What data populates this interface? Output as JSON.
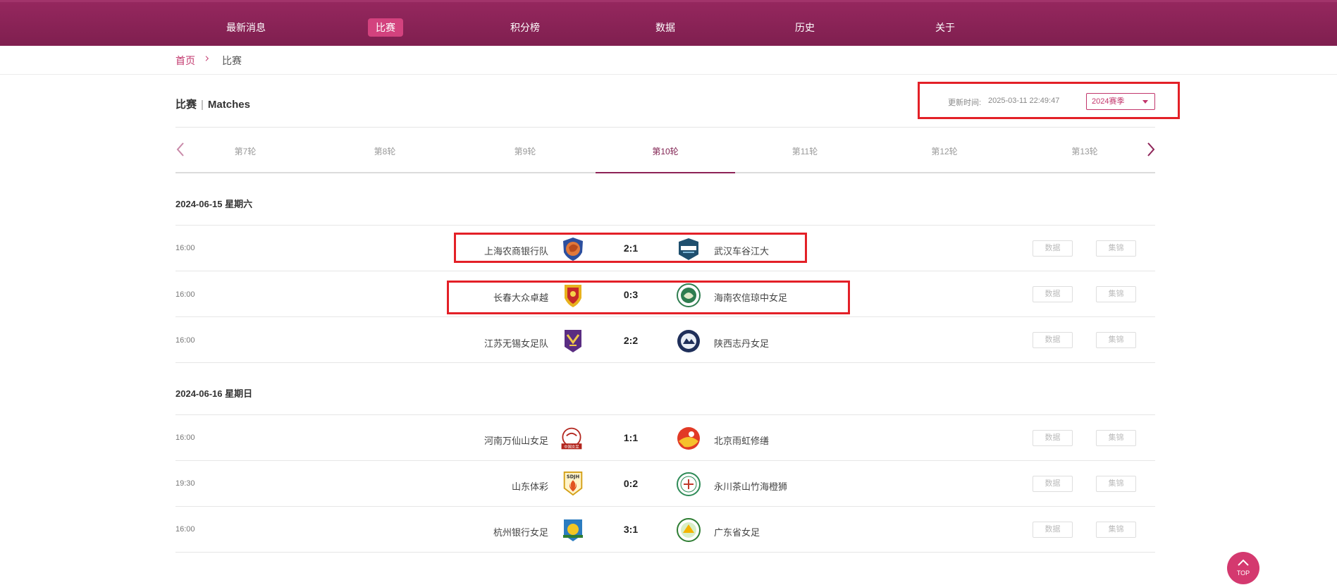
{
  "nav": {
    "items": [
      {
        "label": "最新消息",
        "active": false
      },
      {
        "label": "比赛",
        "active": true
      },
      {
        "label": "积分榜",
        "active": false
      },
      {
        "label": "数据",
        "active": false
      },
      {
        "label": "历史",
        "active": false
      },
      {
        "label": "关于",
        "active": false
      }
    ]
  },
  "breadcrumb": {
    "home": "首页",
    "current": "比赛"
  },
  "section": {
    "title_cn": "比赛",
    "title_en": "Matches"
  },
  "update": {
    "label": "更新时间:",
    "time": "2025-03-11 22:49:47"
  },
  "season_select": {
    "value": "2024赛季"
  },
  "rounds": {
    "tabs": [
      "第7轮",
      "第8轮",
      "第9轮",
      "第10轮",
      "第11轮",
      "第12轮",
      "第13轮"
    ],
    "active": "第10轮"
  },
  "days": [
    {
      "date": "2024-06-15 星期六",
      "matches": [
        {
          "time": "16:00",
          "home": "上海农商银行队",
          "score": "2:1",
          "away": "武汉车谷江大",
          "btn_data": "数据",
          "btn_highlights": "集锦"
        },
        {
          "time": "16:00",
          "home": "长春大众卓越",
          "score": "0:3",
          "away": "海南农信琼中女足",
          "btn_data": "数据",
          "btn_highlights": "集锦"
        },
        {
          "time": "16:00",
          "home": "江苏无锡女足队",
          "score": "2:2",
          "away": "陕西志丹女足",
          "btn_data": "数据",
          "btn_highlights": "集锦"
        }
      ]
    },
    {
      "date": "2024-06-16 星期日",
      "matches": [
        {
          "time": "16:00",
          "home": "河南万仙山女足",
          "score": "1:1",
          "away": "北京雨虹修缮",
          "btn_data": "数据",
          "btn_highlights": "集锦"
        },
        {
          "time": "19:30",
          "home": "山东体彩",
          "score": "0:2",
          "away": "永川茶山竹海橙狮",
          "btn_data": "数据",
          "btn_highlights": "集锦"
        },
        {
          "time": "16:00",
          "home": "杭州银行女足",
          "score": "3:1",
          "away": "广东省女足",
          "btn_data": "数据",
          "btn_highlights": "集锦"
        }
      ]
    }
  ],
  "logos": {
    "henan_text": "中国女足",
    "shandong_text": "SDJH"
  },
  "top_button": {
    "label": "TOP"
  },
  "colors": {
    "brand": "#8d2357",
    "accent": "#d3427e",
    "highlight_box": "#e32027"
  }
}
